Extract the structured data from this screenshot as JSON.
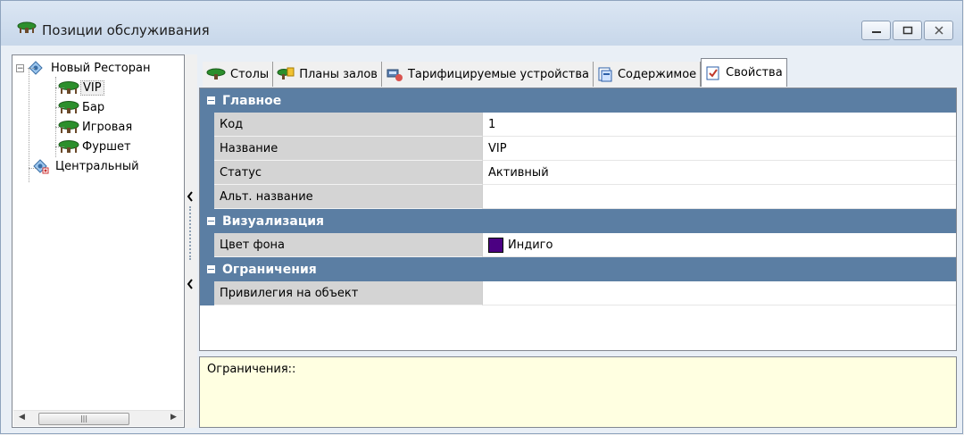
{
  "window": {
    "title": "Позиции обслуживания"
  },
  "tree": {
    "root": "Новый Ресторан",
    "children": [
      "VIP",
      "Бар",
      "Игровая",
      "Фуршет"
    ],
    "second_root": "Центральный",
    "selected": "VIP"
  },
  "tabs": [
    {
      "label": "Столы",
      "icon": "table-icon"
    },
    {
      "label": "Планы залов",
      "icon": "floor-plan-icon"
    },
    {
      "label": "Тарифицируемые устройства",
      "icon": "billing-device-icon"
    },
    {
      "label": "Содержимое",
      "icon": "content-icon"
    },
    {
      "label": "Свойства",
      "icon": "properties-icon",
      "active": true
    }
  ],
  "properties": {
    "main": {
      "title": "Главное",
      "rows": [
        {
          "name": "Код",
          "value": "1"
        },
        {
          "name": "Название",
          "value": "VIP"
        },
        {
          "name": "Статус",
          "value": "Активный"
        },
        {
          "name": "Альт. название",
          "value": ""
        }
      ]
    },
    "visual": {
      "title": "Визуализация",
      "rows": [
        {
          "name": "Цвет фона",
          "value": "Индиго",
          "color": "#4B0082"
        }
      ]
    },
    "restrictions": {
      "title": "Ограничения",
      "rows": [
        {
          "name": "Привилегия на объект",
          "value": ""
        }
      ]
    }
  },
  "description": "Ограничения::",
  "colors": {
    "category_header": "#5B7EA3",
    "description_bg": "#FFFFE1"
  }
}
